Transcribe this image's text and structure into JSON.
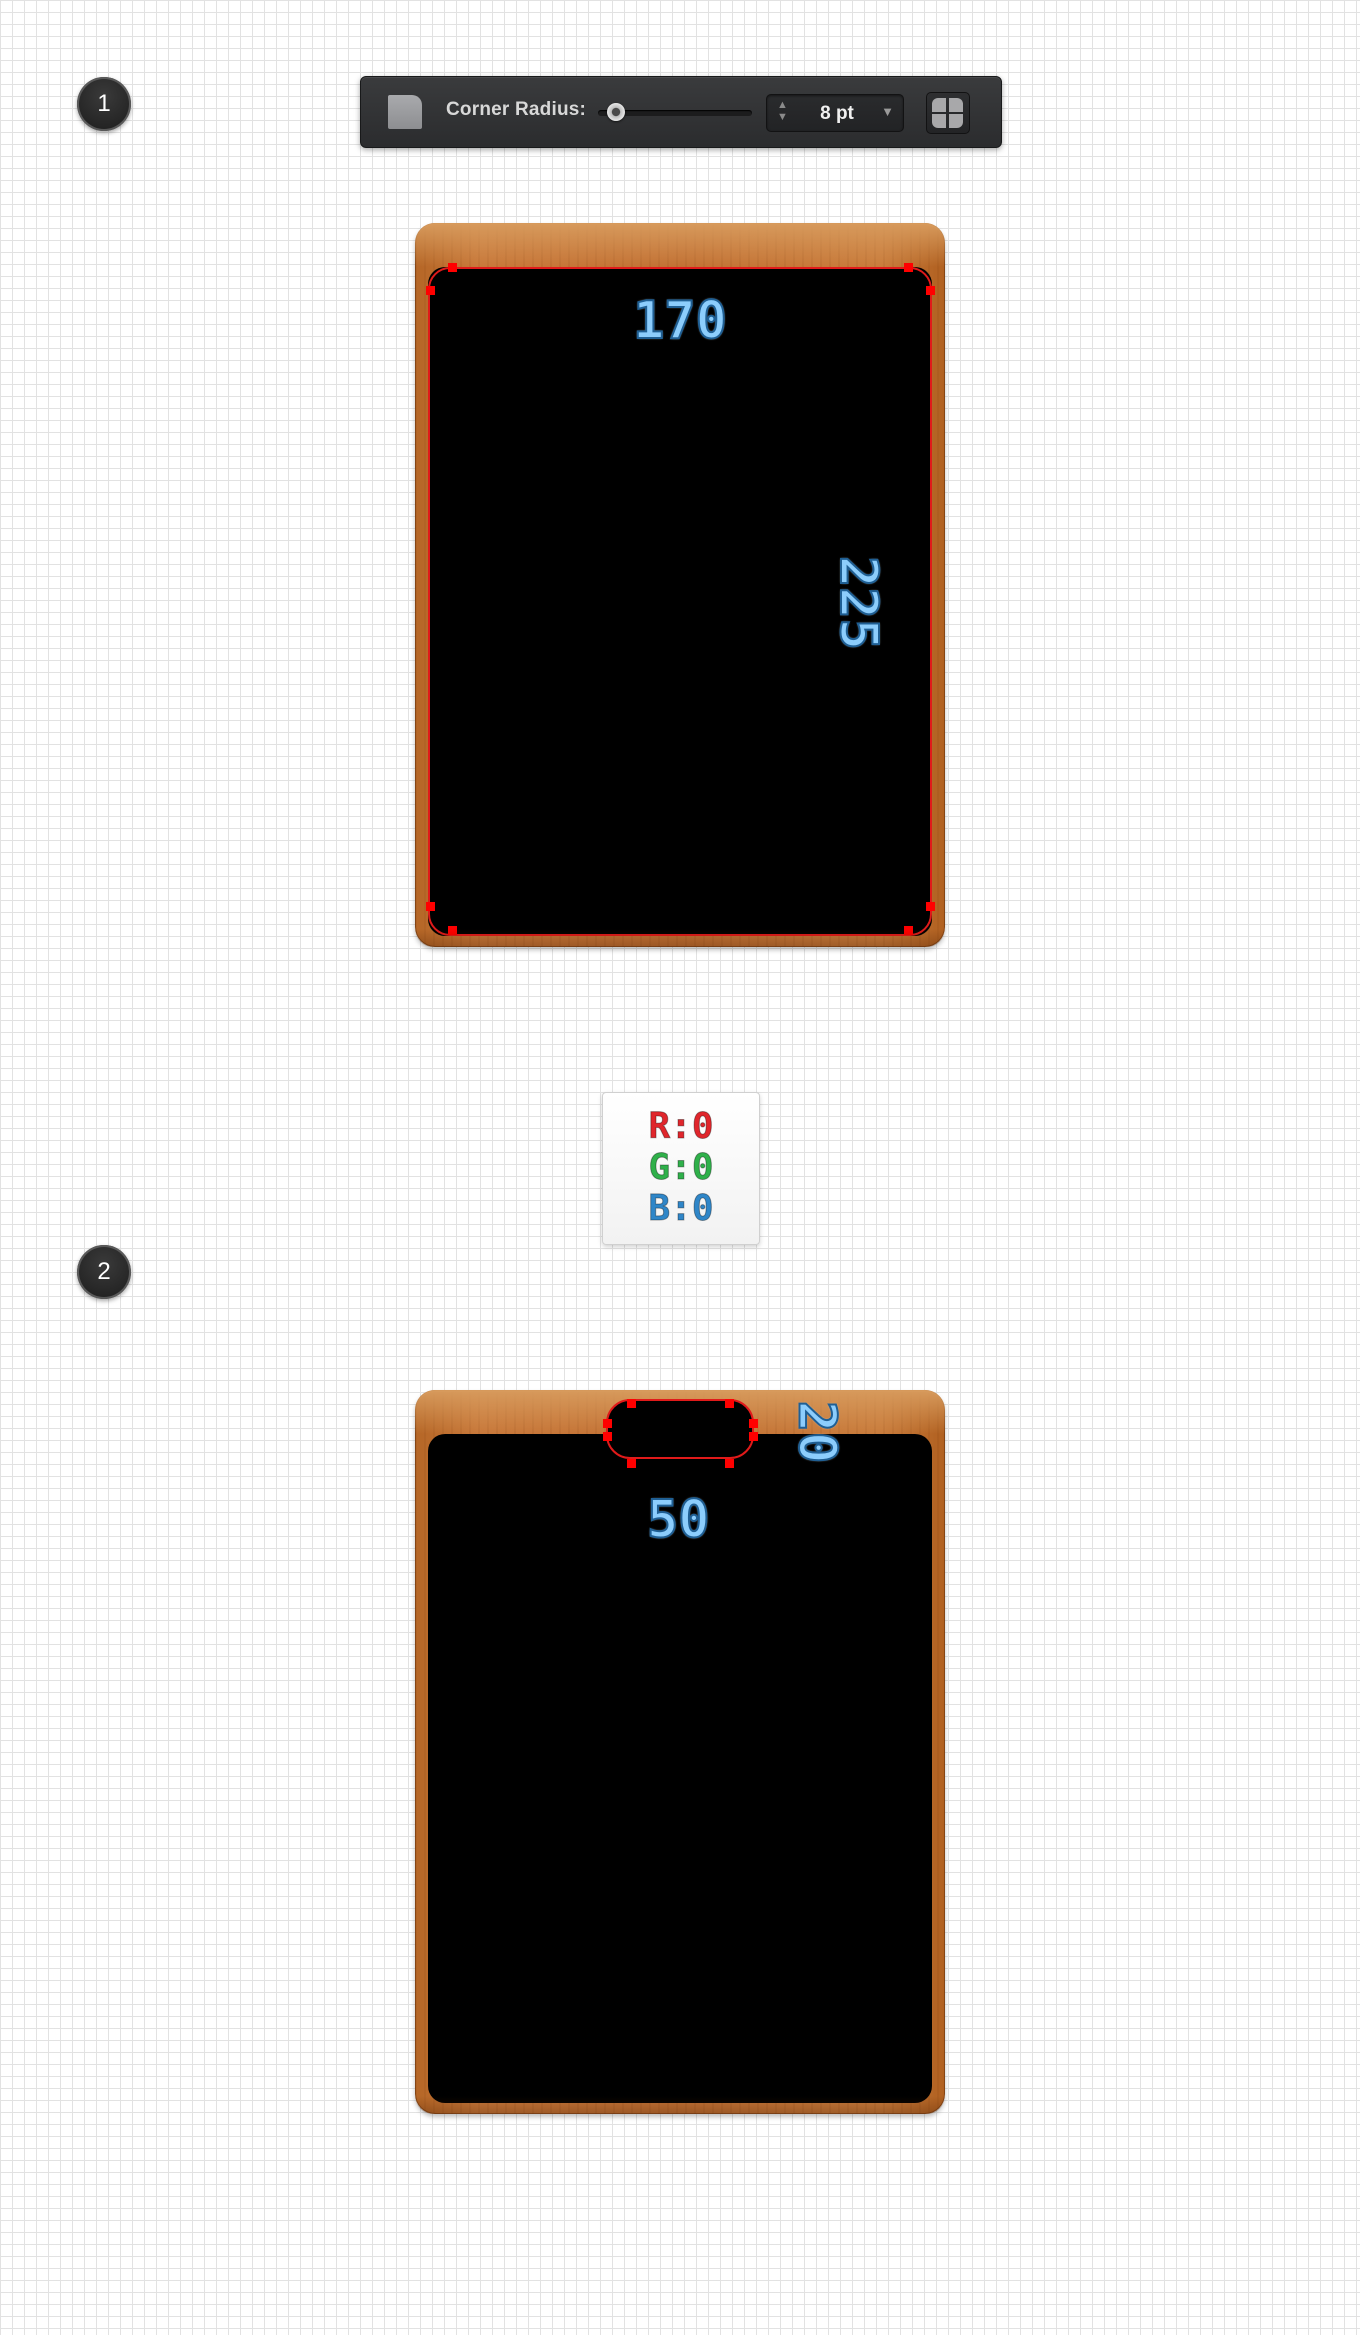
{
  "steps": {
    "step1": "1",
    "step2": "2"
  },
  "toolbar": {
    "shape_icon": "rounded-rectangle-icon",
    "label": "Corner Radius:",
    "slider_value": "8",
    "value": "8 pt",
    "stepper_arrows": "▲▼",
    "dropdown_arrow": "▼",
    "grid_icon": "corners-icon"
  },
  "step1": {
    "width_label": "170",
    "height_label": "225"
  },
  "color_swatch": {
    "r": "R:0",
    "g": "G:0",
    "b": "B:0",
    "colors": {
      "r": "#e0262c",
      "g": "#2fb04a",
      "b": "#2f86c8"
    }
  },
  "step2": {
    "handle_width_label": "50",
    "handle_height_label": "20"
  },
  "colors": {
    "selection": "#e01a1a",
    "fill": "#000000",
    "wood": "#c27134",
    "dimension_text": "#8ccdfc"
  }
}
